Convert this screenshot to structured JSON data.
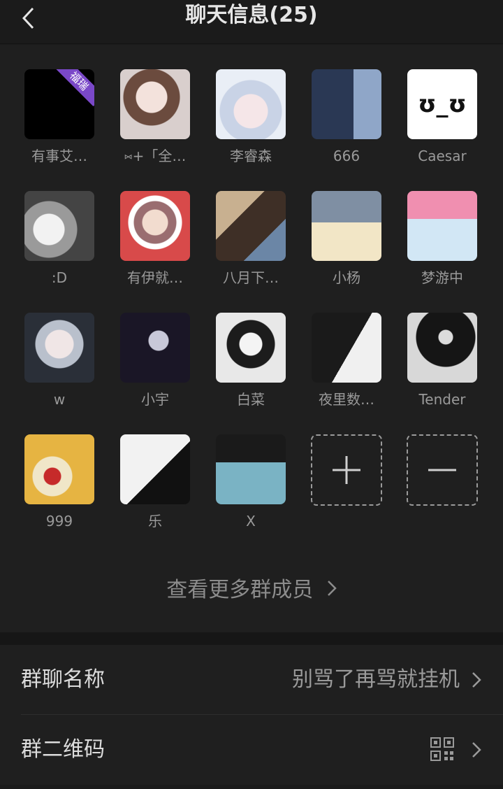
{
  "header": {
    "title": "聊天信息(25)"
  },
  "members": [
    {
      "name": "有事艾…",
      "badge": "福瑞",
      "color": "#000000"
    },
    {
      "name": "⑅+「全…",
      "color": "#cdb9b6"
    },
    {
      "name": "李睿森",
      "color": "#d5dbe8"
    },
    {
      "name": "666",
      "color": "#3b4a66"
    },
    {
      "name": "Caesar",
      "text": "ʊ_ʊ",
      "color": "#ffffff"
    },
    {
      "name": ":D",
      "color": "#8a8a8a"
    },
    {
      "name": "有伊就…",
      "color": "#d84a4a"
    },
    {
      "name": "八月下…",
      "color": "#5c4a3c"
    },
    {
      "name": "小杨",
      "color": "#6a7a90"
    },
    {
      "name": "梦游中",
      "color": "#e79ab3"
    },
    {
      "name": "w",
      "color": "#3c4656"
    },
    {
      "name": "小宇",
      "color": "#2a2440"
    },
    {
      "name": "白菜",
      "color": "#e8e8e8"
    },
    {
      "name": "夜里数…",
      "color": "#4a5a5a"
    },
    {
      "name": "Tender",
      "color": "#2b2b2b"
    },
    {
      "name": "999",
      "color": "#e0b040"
    },
    {
      "name": "乐",
      "color": "#e6e6ee"
    },
    {
      "name": "X",
      "color": "#6aa2b4"
    }
  ],
  "more_members": "查看更多群成员",
  "settings": {
    "group_name_label": "群聊名称",
    "group_name_value": "别骂了再骂就挂机",
    "qr_label": "群二维码"
  },
  "colors": {
    "background": "#1b1b1b",
    "panel": "#1f1f1f",
    "text_primary": "#dcdcdc",
    "text_secondary": "#9a9a9a",
    "badge": "#7a48c8"
  }
}
